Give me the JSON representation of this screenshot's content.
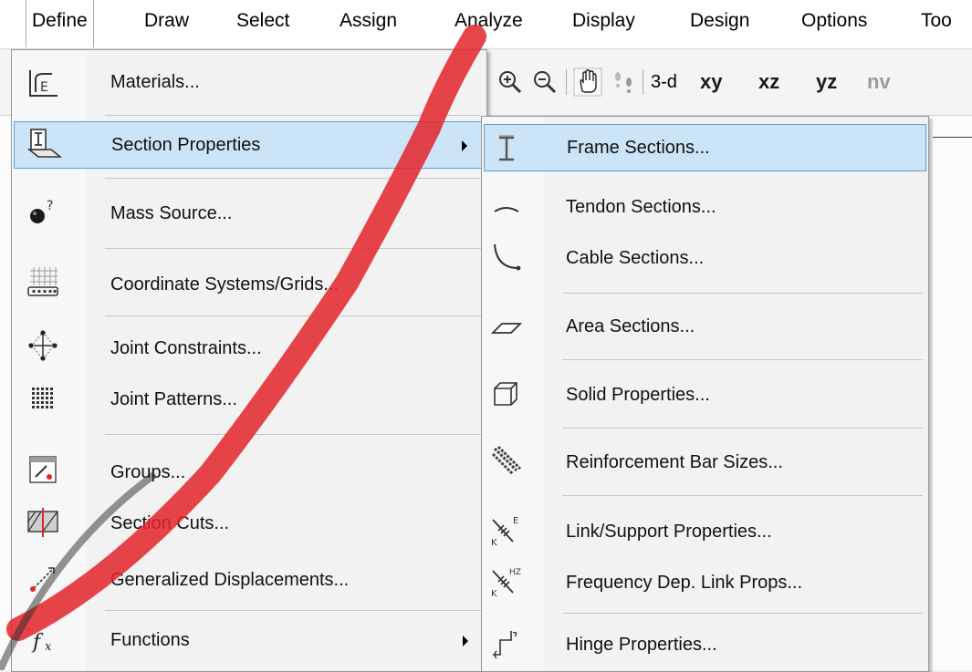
{
  "menubar": {
    "items": [
      "Define",
      "Draw",
      "Select",
      "Assign",
      "Analyze",
      "Display",
      "Design",
      "Options",
      "Too"
    ]
  },
  "toolbar": {
    "zoom_in_icon": "zoom-in-icon",
    "zoom_out_icon": "zoom-out-icon",
    "pan_icon": "pan-hand-icon",
    "walk_icon": "footsteps-icon",
    "view_3d": "3-d",
    "view_xy": "xy",
    "view_xz": "xz",
    "view_yz": "yz",
    "view_nv": "nv"
  },
  "define_menu": {
    "items": [
      {
        "label": "Materials...",
        "icon": "materials-icon",
        "submenu": false
      },
      {
        "label": "Section Properties",
        "icon": "section-properties-icon",
        "submenu": true,
        "highlighted": true
      },
      {
        "label": "Mass Source...",
        "icon": "mass-source-icon",
        "submenu": false
      },
      {
        "label": "Coordinate Systems/Grids...",
        "icon": "grid-icon",
        "submenu": false
      },
      {
        "label": "Joint Constraints...",
        "icon": "joint-constraints-icon",
        "submenu": false
      },
      {
        "label": "Joint Patterns...",
        "icon": "joint-patterns-icon",
        "submenu": false
      },
      {
        "label": "Groups...",
        "icon": "groups-icon",
        "submenu": false
      },
      {
        "label": "Section Cuts...",
        "icon": "section-cuts-icon",
        "submenu": false
      },
      {
        "label": "Generalized Displacements...",
        "icon": "generalized-displacements-icon",
        "submenu": false
      },
      {
        "label": "Functions",
        "icon": "functions-icon",
        "submenu": true
      }
    ]
  },
  "section_submenu": {
    "items": [
      {
        "label": "Frame Sections...",
        "icon": "frame-section-icon",
        "highlighted": true
      },
      {
        "label": "Tendon Sections...",
        "icon": "tendon-icon"
      },
      {
        "label": "Cable Sections...",
        "icon": "cable-icon"
      },
      {
        "label": "Area Sections...",
        "icon": "area-section-icon"
      },
      {
        "label": "Solid Properties...",
        "icon": "solid-icon"
      },
      {
        "label": "Reinforcement Bar Sizes...",
        "icon": "rebar-icon"
      },
      {
        "label": "Link/Support Properties...",
        "icon": "link-support-icon"
      },
      {
        "label": "Frequency Dep. Link Props...",
        "icon": "frequency-link-icon"
      },
      {
        "label": "Hinge Properties...",
        "icon": "hinge-icon"
      }
    ]
  },
  "colors": {
    "highlight_bg": "#cce4f7",
    "highlight_border": "#5a9fd6",
    "watermark": "#e3252b"
  }
}
